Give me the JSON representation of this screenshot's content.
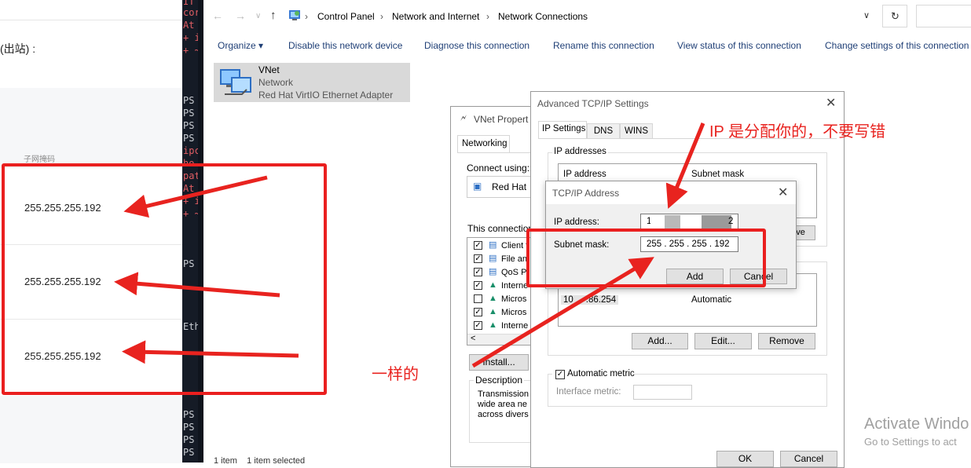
{
  "web": {
    "outbound_label": "(出站) :",
    "subnet_mask_header": "子网掩码",
    "rows": [
      "255.255.255.192",
      "255.255.255.192",
      "255.255.255.192"
    ]
  },
  "terminal": {
    "lines": [
      {
        "text": "IT",
        "color": "red"
      },
      {
        "text": "cor",
        "color": "red"
      },
      {
        "text": "At",
        "color": "red"
      },
      {
        "text": "+ i",
        "color": "red"
      },
      {
        "text": "+ ~",
        "color": "red"
      },
      {
        "text": "PS",
        "color": "white"
      },
      {
        "text": "PS",
        "color": "white"
      },
      {
        "text": "PS",
        "color": "white"
      },
      {
        "text": "PS",
        "color": "white"
      },
      {
        "text": "ipc",
        "color": "red"
      },
      {
        "text": "ho",
        "color": "red"
      },
      {
        "text": "pat",
        "color": "red"
      },
      {
        "text": "At",
        "color": "red"
      },
      {
        "text": "+ i",
        "color": "red"
      },
      {
        "text": "+ ~",
        "color": "red"
      },
      {
        "text": "PS",
        "color": "white"
      },
      {
        "text": "Eth",
        "color": "white"
      },
      {
        "text": "PS",
        "color": "white"
      },
      {
        "text": "PS",
        "color": "white"
      },
      {
        "text": "PS",
        "color": "white"
      },
      {
        "text": "PS",
        "color": "white"
      }
    ]
  },
  "explorer": {
    "breadcrumb": [
      "Control Panel",
      "Network and Internet",
      "Network Connections"
    ],
    "toolbar": [
      "Organize ▾",
      "Disable this network device",
      "Diagnose this connection",
      "Rename this connection",
      "View status of this connection",
      "Change settings of this connection"
    ],
    "adapter": {
      "name": "VNet",
      "type": "Network",
      "device": "Red Hat VirtIO Ethernet Adapter"
    },
    "status_bar": "1 item    1 item selected"
  },
  "vnet_props": {
    "title": "VNet Propert",
    "tab": "Networking",
    "connect_using_label": "Connect using:",
    "adapter_name": "Red Hat",
    "items_label": "This connection",
    "items": [
      {
        "label": "Client f",
        "checked": true
      },
      {
        "label": "File an",
        "checked": true
      },
      {
        "label": "QoS P",
        "checked": true
      },
      {
        "label": "Interne",
        "checked": true
      },
      {
        "label": "Micros",
        "checked": false
      },
      {
        "label": "Micros",
        "checked": true
      },
      {
        "label": "Interne",
        "checked": true
      }
    ],
    "install_button": "Install...",
    "description_label": "Description",
    "description_lines": [
      "Transmission",
      "wide area ne",
      "across divers"
    ]
  },
  "advanced": {
    "title": "Advanced TCP/IP Settings",
    "tabs": [
      "IP Settings",
      "DNS",
      "WINS"
    ],
    "ip_addresses_label": "IP addresses",
    "ip_col": "IP address",
    "mask_col": "Subnet mask",
    "remove_partial": "ve",
    "gateway_value": "10     .86.254",
    "gateway_metric": "Automatic",
    "add_button": "Add...",
    "edit_button": "Edit...",
    "remove_button": "Remove",
    "automatic_metric": "Automatic metric",
    "interface_metric": "Interface metric:",
    "ok_button": "OK",
    "cancel_button": "Cancel"
  },
  "tcpip_address": {
    "title": "TCP/IP Address",
    "ip_label": "IP address:",
    "ip_value_start": "1",
    "ip_value_end": "2",
    "mask_label": "Subnet mask:",
    "mask_value": "255 . 255 . 255 . 192",
    "add_button": "Add",
    "cancel_button": "Cancel"
  },
  "annotations": {
    "ip_note": "IP 是分配你的，不要写错",
    "same_note": "一样的"
  },
  "watermark": {
    "line1": "Activate Windo",
    "line2": "Go to Settings to act"
  },
  "colors": {
    "annotation_red": "#e8231f",
    "link_blue": "#1f3f76"
  }
}
